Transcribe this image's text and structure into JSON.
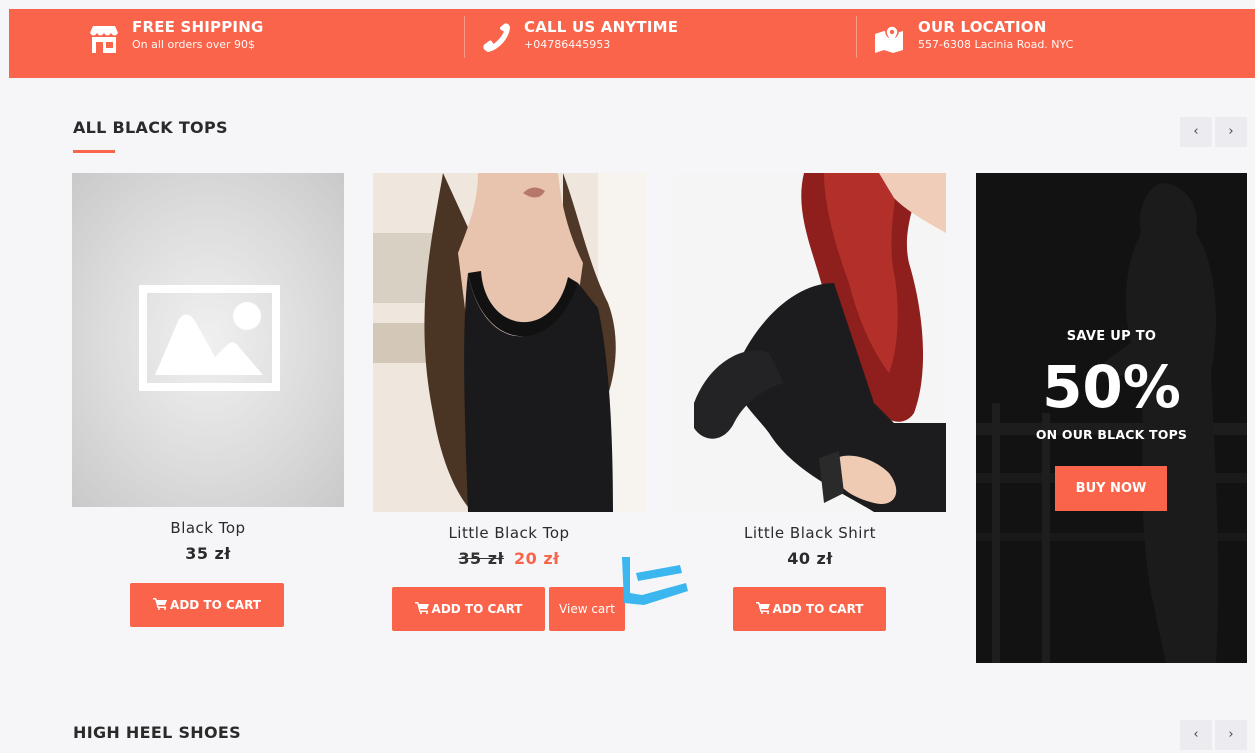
{
  "infobar": {
    "items": [
      {
        "title": "FREE SHIPPING",
        "subtitle": "On all orders over 90$",
        "icon": "store-icon"
      },
      {
        "title": "CALL US ANYTIME",
        "subtitle": "+04786445953",
        "icon": "phone-icon"
      },
      {
        "title": "OUR LOCATION",
        "subtitle": "557-6308 Lacinia Road. NYC",
        "icon": "map-icon"
      }
    ]
  },
  "sections": [
    {
      "title": "ALL BLACK TOPS",
      "prev": "‹",
      "next": "›"
    },
    {
      "title": "HIGH HEEL SHOES",
      "prev": "‹",
      "next": "›"
    }
  ],
  "products": [
    {
      "name": "Black Top",
      "price": "35 zł",
      "add_label": "ADD TO CART",
      "image": "placeholder-image"
    },
    {
      "name": "Little Black Top",
      "old_price": "35 zł",
      "price": "20 zł",
      "add_label": "ADD TO CART",
      "view_label": "View cart",
      "image": "woman-black-tank-top"
    },
    {
      "name": "Little Black Shirt",
      "price": "40 zł",
      "add_label": "ADD TO CART",
      "image": "woman-black-shirt"
    }
  ],
  "promo": {
    "line1": "SAVE UP TO",
    "percent": "50%",
    "line2": "ON OUR BLACK TOPS",
    "button": "BUY NOW"
  },
  "colors": {
    "accent": "#f9644b",
    "annotation_arrow": "#3bb6ee",
    "background": "#f6f6f9"
  }
}
